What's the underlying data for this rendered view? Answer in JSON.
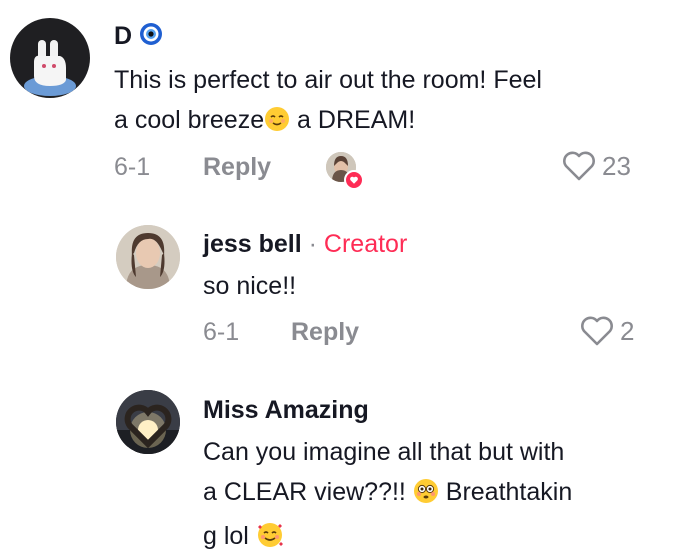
{
  "comments": [
    {
      "author": "D",
      "author_badge": "nazar-eye-emoji",
      "text_a": "This is perfect to air out the room! Feel",
      "text_b1": "a cool breeze",
      "text_b2": " a DREAM!",
      "emoji_b": "relieved-face-emoji",
      "date": "6-1",
      "reply_label": "Reply",
      "likes": "23",
      "creator_liked": true
    },
    {
      "author": "jess bell",
      "role_sep": "·",
      "role": "Creator",
      "text": "so nice!!",
      "date": "6-1",
      "reply_label": "Reply",
      "likes": "2"
    },
    {
      "author": "Miss Amazing",
      "text_a": "Can you imagine all that but with",
      "text_b1": "a CLEAR view??!! ",
      "text_b2": " Breathtakin",
      "emoji_b": "flushed-face-emoji",
      "text_c": "g lol ",
      "emoji_c": "smiling-face-with-hearts-emoji"
    }
  ],
  "colors": {
    "creator": "#fe2c55",
    "muted": "#8a8b91",
    "text": "#161823"
  }
}
